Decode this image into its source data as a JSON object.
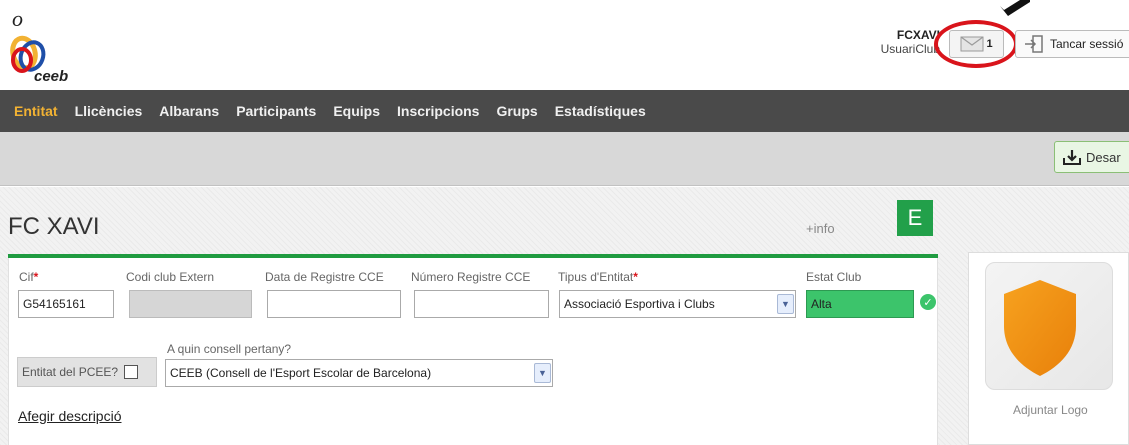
{
  "header": {
    "logo_text": "ceeb",
    "user_name": "FCXAVI",
    "user_role": "UsuariClub",
    "messages_count": "1",
    "logout_label": "Tancar sessió"
  },
  "nav": {
    "items": [
      {
        "label": "Entitat",
        "active": true
      },
      {
        "label": "Llicències",
        "active": false
      },
      {
        "label": "Albarans",
        "active": false
      },
      {
        "label": "Participants",
        "active": false
      },
      {
        "label": "Equips",
        "active": false
      },
      {
        "label": "Inscripcions",
        "active": false
      },
      {
        "label": "Grups",
        "active": false
      },
      {
        "label": "Estadístiques",
        "active": false
      }
    ]
  },
  "toolbar": {
    "download_label": "Desar"
  },
  "entity": {
    "title": "FC XAVI",
    "info_link": "+info",
    "badge": "E"
  },
  "form": {
    "cif_label": "Cif",
    "cif_value": "G54165161",
    "codi_label": "Codi club Extern",
    "codi_value": "",
    "data_label": "Data de Registre CCE",
    "data_value": "",
    "numero_label": "Número Registre CCE",
    "numero_value": "",
    "tipus_label": "Tipus d'Entitat",
    "tipus_value": "Associació Esportiva i Clubs",
    "estat_label": "Estat Club",
    "estat_value": "Alta",
    "pcee_label": "Entitat del PCEE?",
    "consell_label": "A quin consell pertany?",
    "consell_value": "CEEB (Consell de l'Esport Escolar de Barcelona)",
    "add_description": "Afegir descripció",
    "required_mark": "*"
  },
  "logo_panel": {
    "attach_label": "Adjuntar Logo"
  },
  "colors": {
    "nav_bg": "#4a4a4a",
    "nav_active": "#f2b233",
    "accent_green": "#1f9b40",
    "status_green": "#3cc46b",
    "highlight_red": "#d9141b",
    "shield_orange": "#f39200"
  }
}
